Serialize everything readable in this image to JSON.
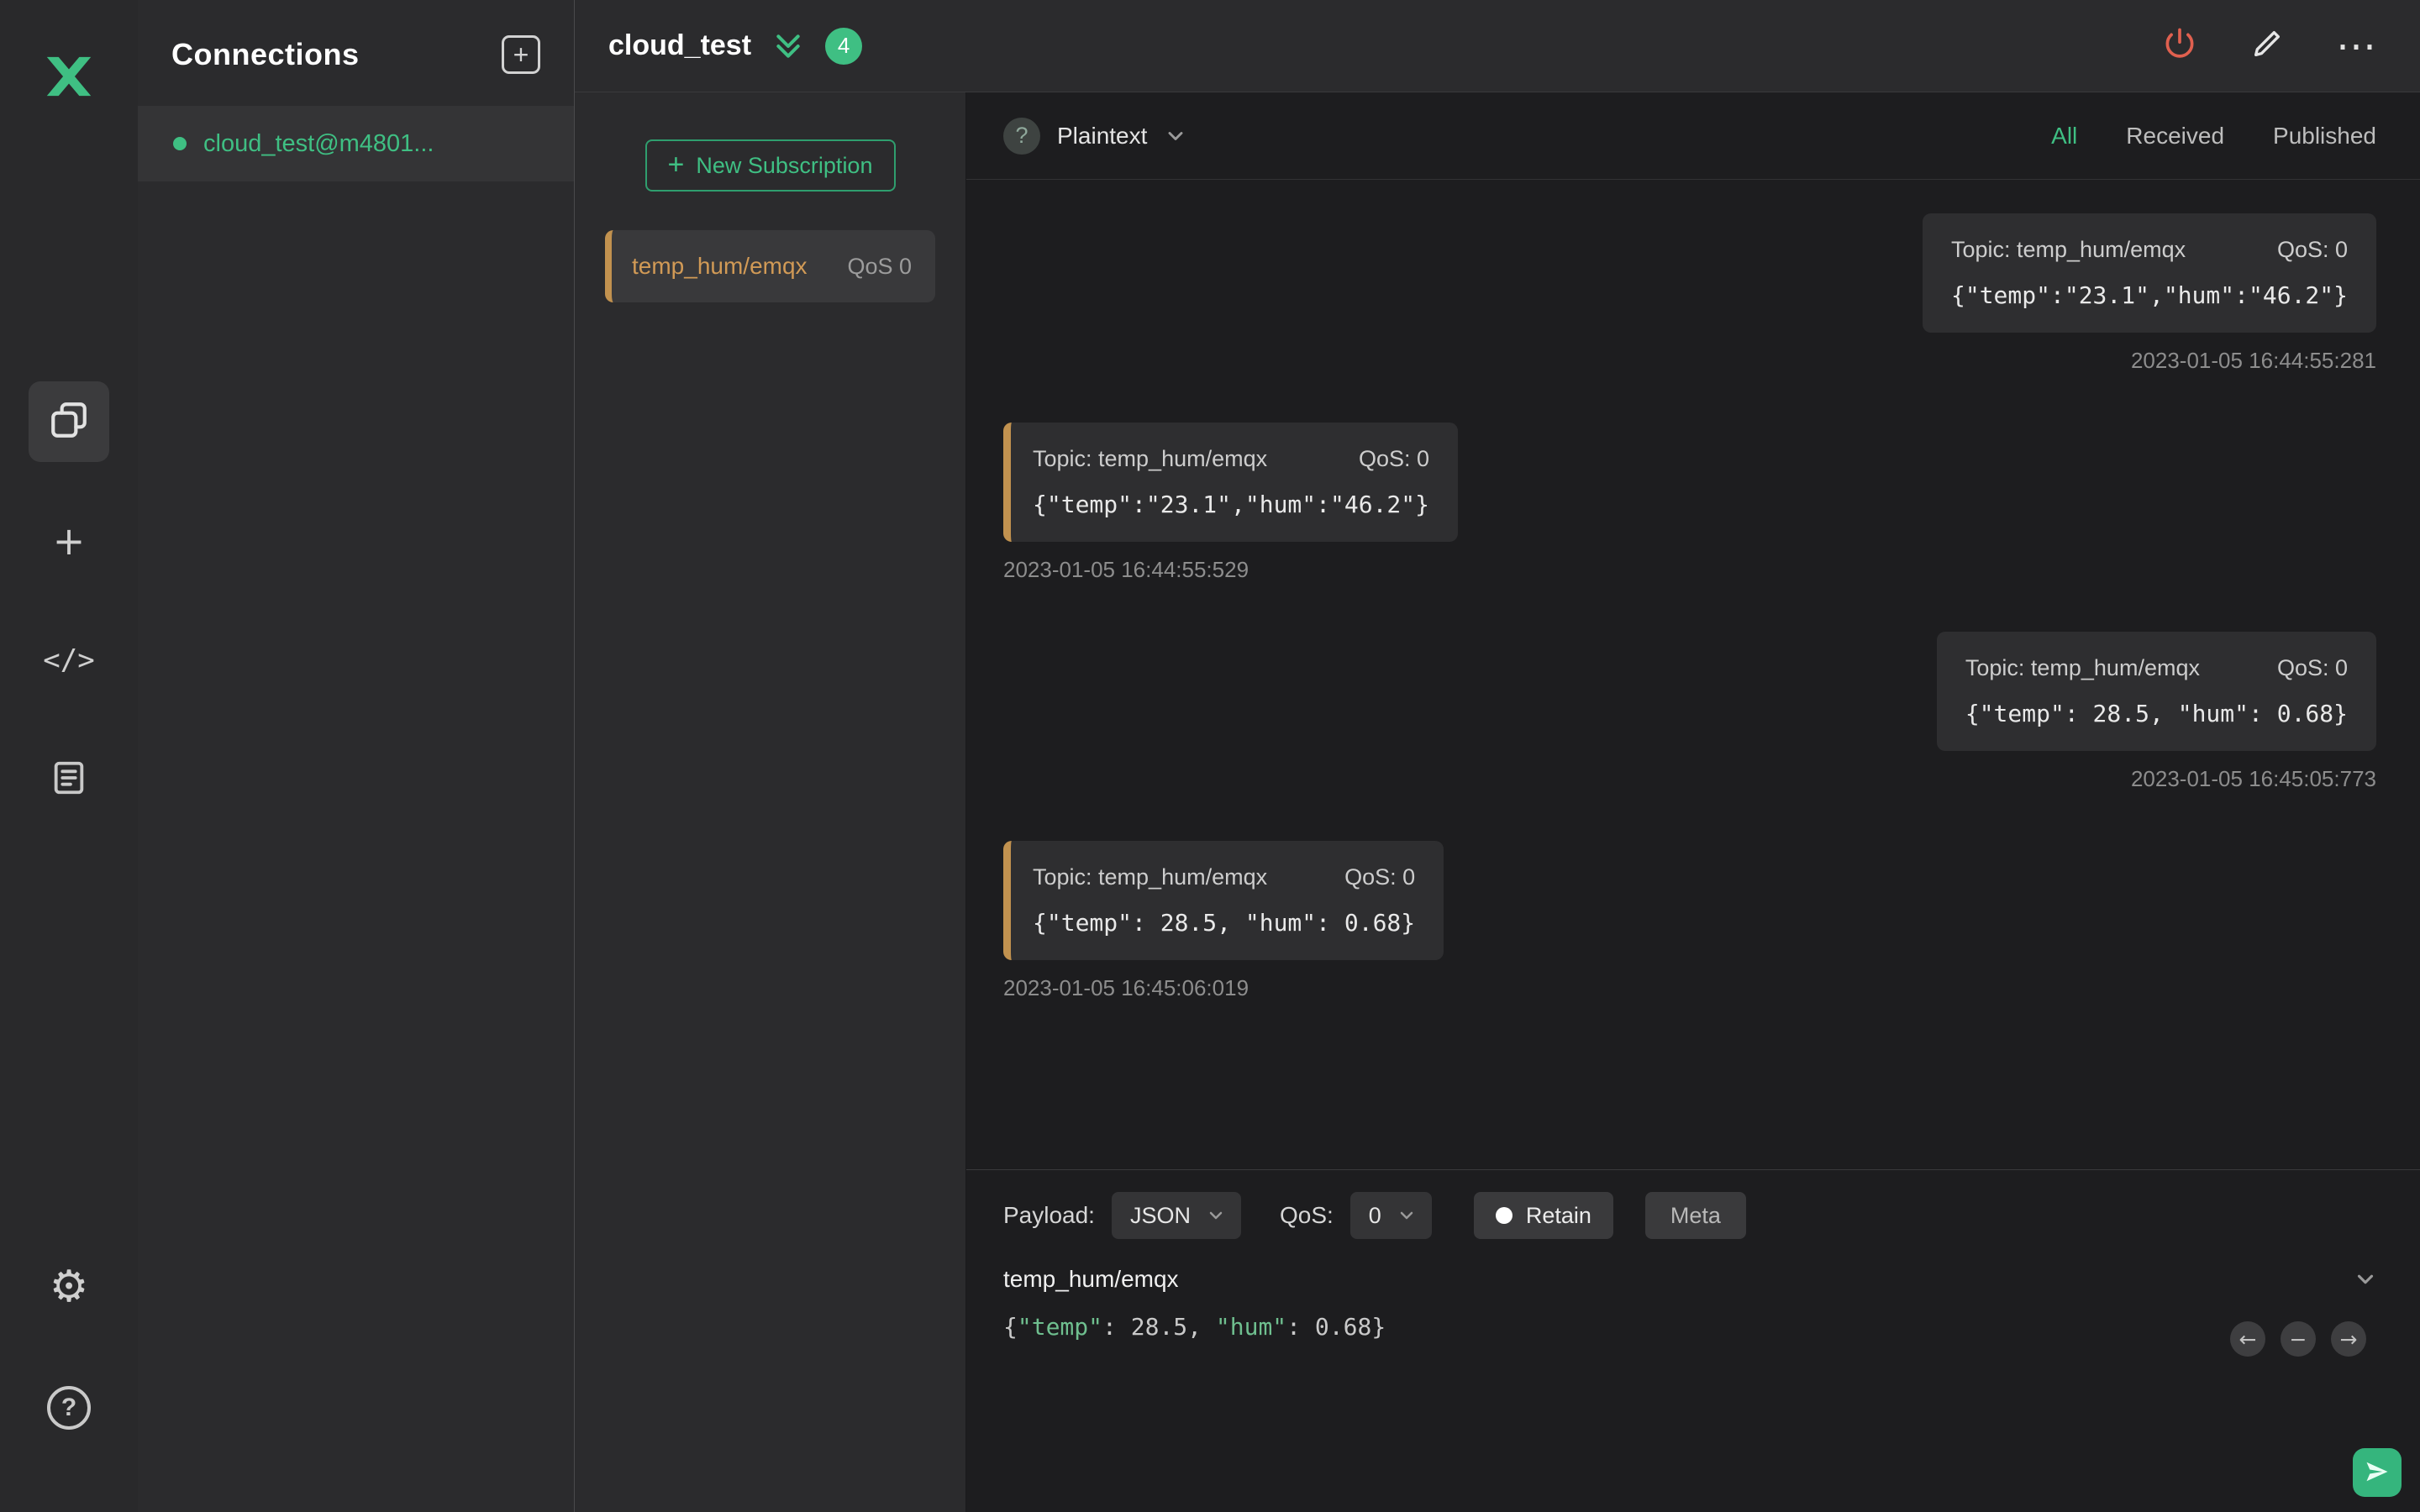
{
  "header": {
    "title": "cloud_test",
    "badge": "4",
    "more_glyph": "⋯"
  },
  "rail": {
    "plus_glyph": "+",
    "code_glyph": "</>",
    "gear_glyph": "⚙",
    "help_glyph": "?"
  },
  "connections": {
    "title": "Connections",
    "add_glyph": "+",
    "items": [
      {
        "name": "cloud_test@m4801...",
        "status": "connected"
      }
    ]
  },
  "subscriptions": {
    "new_button_label": "New Subscription",
    "plus_glyph": "+",
    "items": [
      {
        "topic": "temp_hum/emqx",
        "qos": "QoS 0"
      }
    ]
  },
  "messages": {
    "help_glyph": "?",
    "format": "Plaintext",
    "filters": [
      "All",
      "Received",
      "Published"
    ],
    "active_filter": "All",
    "items": [
      {
        "type": "published",
        "topic": "Topic: temp_hum/emqx",
        "qos": "QoS: 0",
        "payload": "{\"temp\":\"23.1\",\"hum\":\"46.2\"}",
        "time": "2023-01-05 16:44:55:281"
      },
      {
        "type": "received",
        "topic": "Topic: temp_hum/emqx",
        "qos": "QoS: 0",
        "payload": "{\"temp\":\"23.1\",\"hum\":\"46.2\"}",
        "time": "2023-01-05 16:44:55:529"
      },
      {
        "type": "published",
        "topic": "Topic: temp_hum/emqx",
        "qos": "QoS: 0",
        "payload": "{\"temp\": 28.5, \"hum\": 0.68}",
        "time": "2023-01-05 16:45:05:773"
      },
      {
        "type": "received",
        "topic": "Topic: temp_hum/emqx",
        "qos": "QoS: 0",
        "payload": "{\"temp\": 28.5, \"hum\": 0.68}",
        "time": "2023-01-05 16:45:06:019"
      }
    ]
  },
  "publish": {
    "payload_label": "Payload:",
    "payload_type": "JSON",
    "qos_label": "QoS:",
    "qos_value": "0",
    "retain_label": "Retain",
    "meta_label": "Meta",
    "topic": "temp_hum/emqx",
    "payload_text": "{\"temp\": 28.5, \"hum\": 0.68}",
    "prev_glyph": "←",
    "minus_glyph": "−",
    "next_glyph": "→"
  },
  "colors": {
    "accent_green": "#3fbf83",
    "topic_orange": "#c2924f",
    "power_red": "#e0604f",
    "badge_green": "#3fbf83"
  }
}
